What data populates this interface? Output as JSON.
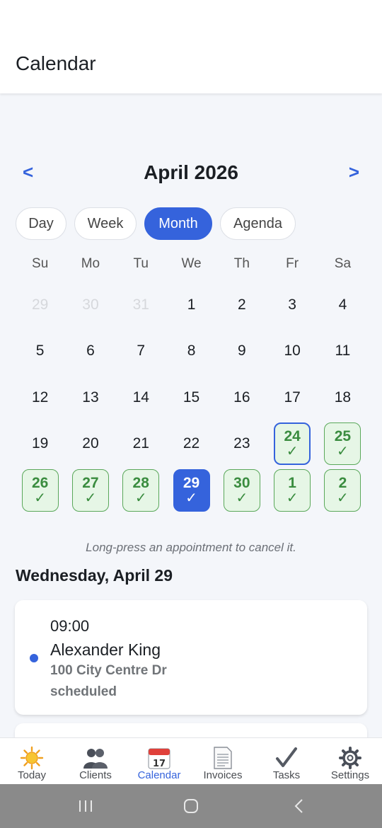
{
  "header": {
    "title": "Calendar"
  },
  "month_nav": {
    "prev": "<",
    "next": ">",
    "title": "April 2026"
  },
  "view_tabs": [
    {
      "label": "Day",
      "active": false
    },
    {
      "label": "Week",
      "active": false
    },
    {
      "label": "Month",
      "active": true
    },
    {
      "label": "Agenda",
      "active": false
    }
  ],
  "weekdays": [
    "Su",
    "Mo",
    "Tu",
    "We",
    "Th",
    "Fr",
    "Sa"
  ],
  "days": [
    {
      "label": "29",
      "state": "muted"
    },
    {
      "label": "30",
      "state": "muted"
    },
    {
      "label": "31",
      "state": "muted"
    },
    {
      "label": "1",
      "state": "normal"
    },
    {
      "label": "2",
      "state": "normal"
    },
    {
      "label": "3",
      "state": "normal"
    },
    {
      "label": "4",
      "state": "normal"
    },
    {
      "label": "5",
      "state": "normal"
    },
    {
      "label": "6",
      "state": "normal"
    },
    {
      "label": "7",
      "state": "normal"
    },
    {
      "label": "8",
      "state": "normal"
    },
    {
      "label": "9",
      "state": "normal"
    },
    {
      "label": "10",
      "state": "normal"
    },
    {
      "label": "11",
      "state": "normal"
    },
    {
      "label": "12",
      "state": "normal"
    },
    {
      "label": "13",
      "state": "normal"
    },
    {
      "label": "14",
      "state": "normal"
    },
    {
      "label": "15",
      "state": "normal"
    },
    {
      "label": "16",
      "state": "normal"
    },
    {
      "label": "17",
      "state": "normal"
    },
    {
      "label": "18",
      "state": "normal"
    },
    {
      "label": "19",
      "state": "normal"
    },
    {
      "label": "20",
      "state": "normal"
    },
    {
      "label": "21",
      "state": "normal"
    },
    {
      "label": "22",
      "state": "normal"
    },
    {
      "label": "23",
      "state": "normal"
    },
    {
      "label": "24",
      "state": "booked-outline",
      "check": "✓"
    },
    {
      "label": "25",
      "state": "booked",
      "check": "✓"
    },
    {
      "label": "26",
      "state": "booked",
      "check": "✓"
    },
    {
      "label": "27",
      "state": "booked",
      "check": "✓"
    },
    {
      "label": "28",
      "state": "booked",
      "check": "✓"
    },
    {
      "label": "29",
      "state": "selected",
      "check": "✓"
    },
    {
      "label": "30",
      "state": "booked",
      "check": "✓"
    },
    {
      "label": "1",
      "state": "booked",
      "check": "✓"
    },
    {
      "label": "2",
      "state": "booked",
      "check": "✓"
    }
  ],
  "hint": "Long-press an appointment to cancel it.",
  "selected_date_heading": "Wednesday, April 29",
  "appointment": {
    "time": "09:00",
    "client": "Alexander King",
    "address": "100 City Centre Dr",
    "status": "scheduled"
  },
  "bottom_nav": [
    {
      "label": "Today",
      "icon": "sun-icon",
      "active": false
    },
    {
      "label": "Clients",
      "icon": "people-icon",
      "active": false
    },
    {
      "label": "Calendar",
      "icon": "calendar-icon",
      "active": true
    },
    {
      "label": "Invoices",
      "icon": "document-icon",
      "active": false
    },
    {
      "label": "Tasks",
      "icon": "checkmark-icon",
      "active": false
    },
    {
      "label": "Settings",
      "icon": "gear-icon",
      "active": false
    }
  ],
  "colors": {
    "accent": "#3563dc",
    "booked_bg": "#e6f6e6",
    "booked_text": "#3a8c3f"
  }
}
